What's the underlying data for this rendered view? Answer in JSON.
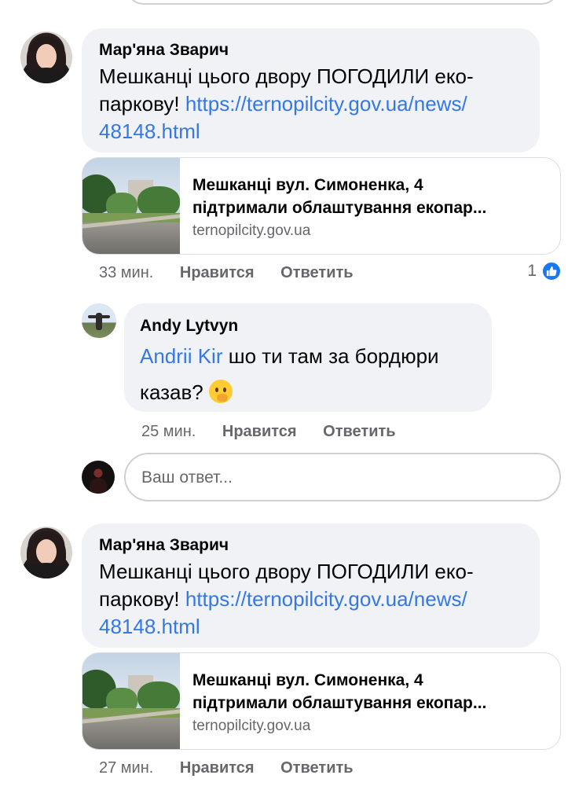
{
  "comments": [
    {
      "author": "Мар'яна Зварич",
      "text_line1": "Мешканці цього двору ПОГОДИЛИ еко-",
      "text_line2_prefix": "паркову! ",
      "link_part1": "https://ternopilcity.gov.ua/news/",
      "link_part2": "48148.html",
      "preview": {
        "title_line1": "Мешканці вул. Симоненка, 4",
        "title_line2": "підтримали облаштування екопар...",
        "domain": "ternopilcity.gov.ua"
      },
      "time": "33 мин.",
      "like_label": "Нравится",
      "reply_label": "Ответить",
      "reaction_count": "1"
    },
    {
      "author": "Andy Lytvyn",
      "mention": "Andrii Kir",
      "text_rest": " шо ти там за бордюри",
      "text_line2": "казав? ",
      "emoji": "thinking-face-emoji",
      "time": "25 мин.",
      "like_label": "Нравится",
      "reply_label": "Ответить"
    },
    {
      "author": "Мар'яна Зварич",
      "text_line1": "Мешканці цього двору ПОГОДИЛИ еко-",
      "text_line2_prefix": "паркову! ",
      "link_part1": "https://ternopilcity.gov.ua/news/",
      "link_part2": "48148.html",
      "preview": {
        "title_line1": "Мешканці вул. Симоненка, 4",
        "title_line2": "підтримали облаштування екопар...",
        "domain": "ternopilcity.gov.ua"
      },
      "time": "27 мин.",
      "like_label": "Нравится",
      "reply_label": "Ответить"
    }
  ],
  "reply_box": {
    "placeholder": "Ваш ответ..."
  },
  "colors": {
    "link": "#3578e5",
    "bubble": "#f0f2f5",
    "meta": "#65676b",
    "like_badge": "#1877f2"
  }
}
